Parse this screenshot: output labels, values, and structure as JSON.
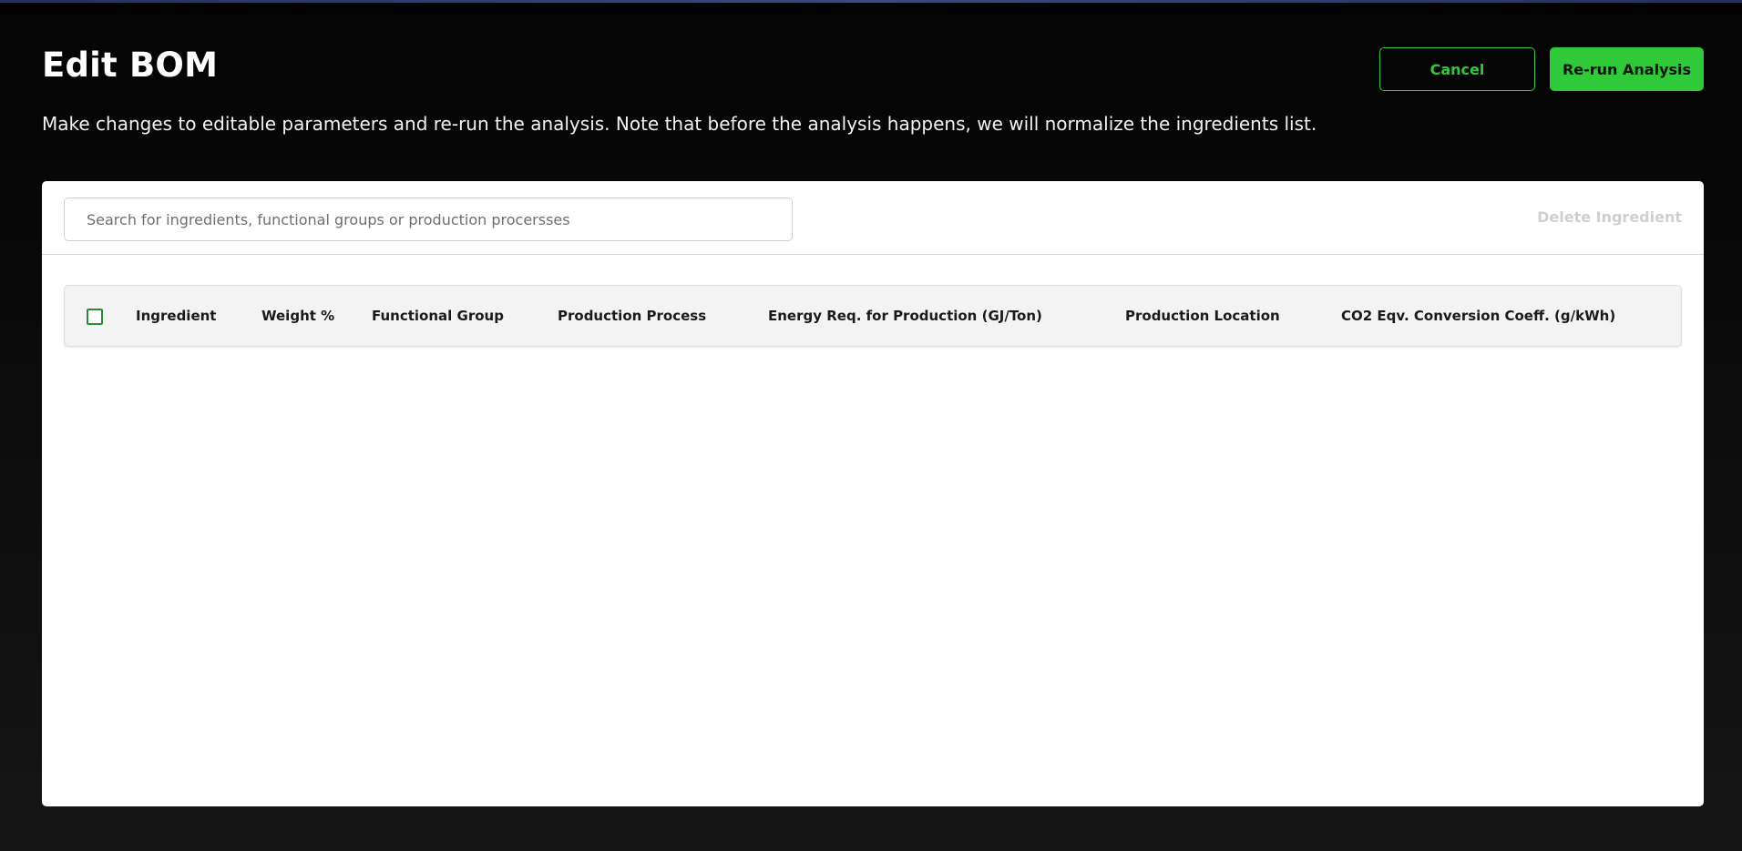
{
  "page": {
    "title": "Edit BOM",
    "description": "Make changes to editable parameters and re-run the analysis. Note that before the analysis happens, we will normalize the ingredients list."
  },
  "actions": {
    "cancel_label": "Cancel",
    "rerun_label": "Re-run Analysis"
  },
  "toolbar": {
    "search_placeholder": "Search for ingredients, functional groups or production procersses",
    "search_value": "",
    "delete_label": "Delete Ingredient"
  },
  "table": {
    "columns": [
      "Ingredient",
      "Weight %",
      "Functional Group",
      "Production Process",
      "Energy Req. for Production (GJ/Ton)",
      "Production Location",
      "CO2 Eqv. Conversion Coeff. (g/kWh)"
    ],
    "rows": []
  },
  "colors": {
    "accent": "#2fc93a",
    "background": "#0b0b0b",
    "panel": "#ffffff",
    "disabled_text": "#cfcfcf"
  }
}
